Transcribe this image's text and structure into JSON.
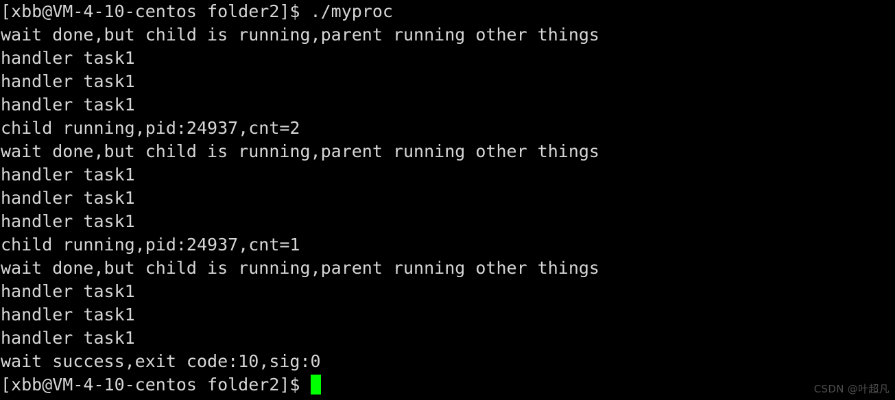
{
  "terminal": {
    "background_color": "#000000",
    "text_color": "#d6d6d6",
    "cursor_color": "#00ff00",
    "prompt": "[xbb@VM-4-10-centos folder2]$ ",
    "command": "./myproc",
    "lines": [
      "[xbb@VM-4-10-centos folder2]$ ./myproc",
      "wait done,but child is running,parent running other things",
      "handler task1",
      "handler task1",
      "handler task1",
      "child running,pid:24937,cnt=2",
      "wait done,but child is running,parent running other things",
      "handler task1",
      "handler task1",
      "handler task1",
      "child running,pid:24937,cnt=1",
      "wait done,but child is running,parent running other things",
      "handler task1",
      "handler task1",
      "handler task1",
      "wait success,exit code:10,sig:0"
    ],
    "final_prompt": "[xbb@VM-4-10-centos folder2]$ "
  },
  "watermark": {
    "text": "CSDN @叶超凡"
  }
}
